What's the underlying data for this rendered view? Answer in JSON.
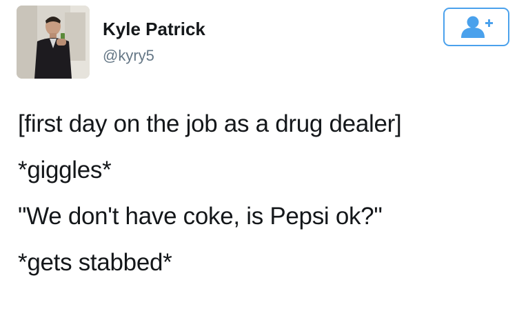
{
  "user": {
    "display_name": "Kyle Patrick",
    "handle": "@kyry5",
    "avatar_icon": "profile-photo",
    "follow_icon": "add-user-icon"
  },
  "tweet": {
    "lines": [
      "[first day on the job as a drug dealer]",
      "*giggles*",
      "\"We don't have coke, is Pepsi ok?\"",
      "*gets stabbed*"
    ]
  },
  "colors": {
    "accent": "#4aa1ec",
    "handle": "#657786",
    "text": "#14171a"
  }
}
